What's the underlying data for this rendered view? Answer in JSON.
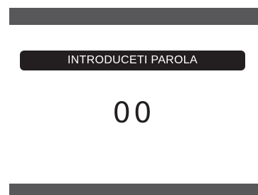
{
  "screen": {
    "prompt_label": "INTRODUCETI PAROLA",
    "password_value": "00"
  },
  "colors": {
    "bar": "#58585a",
    "label_background": "#231f20",
    "label_text": "#ffffff",
    "value_text": "#231f20",
    "background": "#ffffff"
  }
}
